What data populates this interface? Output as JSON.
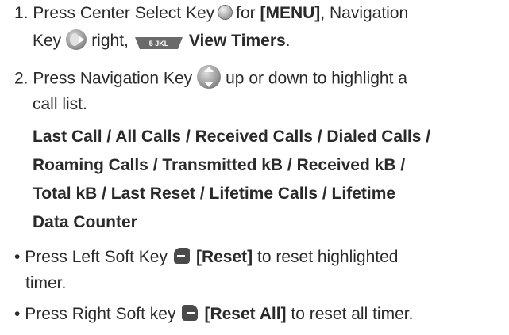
{
  "step1": {
    "number": "1.",
    "text_a": "Press Center Select Key",
    "text_b": "for",
    "menu": "[MENU]",
    "text_c": ", Navigation",
    "line2_a": "Key",
    "line2_b": "right,",
    "key5_label": "5 JKL",
    "view_timers": "View Timers",
    "period": "."
  },
  "step2": {
    "number": "2.",
    "text_a": "Press Navigation Key",
    "text_b": "up or down to highlight a",
    "line2": "call list.",
    "options": [
      "Last Call / All Calls / Received Calls / Dialed Calls /",
      "Roaming Calls / Transmitted kB / Received kB /",
      "Total kB / Last Reset / Lifetime Calls / Lifetime",
      "Data Counter"
    ]
  },
  "bullets": [
    {
      "bullet": "•",
      "text_a": "Press Left Soft Key",
      "action": "[Reset]",
      "text_b": "to reset highlighted",
      "line2": "timer."
    },
    {
      "bullet": "•",
      "text_a": "Press Right Soft key",
      "action": "[Reset All]",
      "text_b": "to reset all timer."
    }
  ],
  "icons": {
    "center_select": "center-select-key-icon",
    "nav_right": "navigation-key-right-icon",
    "key5": "key-5-jkl-icon",
    "nav_updown": "navigation-key-up-down-icon",
    "left_soft": "left-soft-key-icon",
    "right_soft": "right-soft-key-icon"
  },
  "colors": {
    "text": "#2a2a2a",
    "icon_grey": "#9a9a9a",
    "key_dark": "#4a4a4a"
  }
}
